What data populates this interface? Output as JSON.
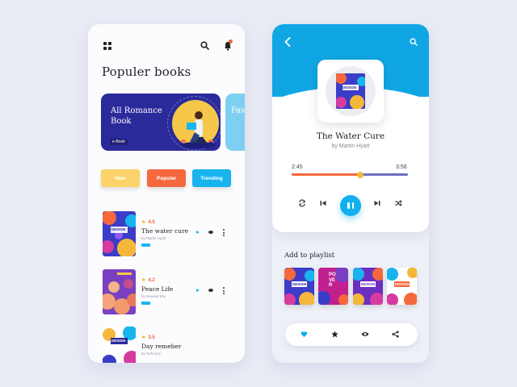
{
  "left": {
    "title": "Populer books",
    "banners": [
      {
        "title": "All  Romance Book",
        "tag": "e-Book"
      },
      {
        "title": "Favr Boo"
      }
    ],
    "filters": [
      "New",
      "Populer",
      "Trending"
    ],
    "books": [
      {
        "rating": "4.5",
        "title": "The water cure",
        "author": "by Martin Hyatt",
        "cover_text": "DESIGN"
      },
      {
        "rating": "4.2",
        "title": "Peace Life",
        "author": "by Naveed Elis",
        "cover_text": ""
      },
      {
        "rating": "3.5",
        "title": "Day remeber",
        "author": "by Nehoney",
        "cover_text": "DESIGN"
      }
    ],
    "icons": [
      "grid-icon",
      "search-icon",
      "bell-icon"
    ]
  },
  "player": {
    "track_title": "The Water Cure",
    "artist": "by Martin Hyatt",
    "current_time": "2:45",
    "total_time": "3:56",
    "progress": 0.59,
    "album_text": "DESIGN",
    "controls": [
      "repeat-icon",
      "previous-icon",
      "pause-icon",
      "next-icon",
      "shuffle-icon"
    ]
  },
  "playlist": {
    "label": "Add to playlist",
    "thumbs": [
      {
        "text": "DESIGN"
      },
      {
        "text": "POVER"
      },
      {
        "text": "DESIGN"
      },
      {
        "text": "DESIGN"
      }
    ],
    "actions": [
      "heart-icon",
      "star-icon",
      "eye-icon",
      "share-icon"
    ]
  },
  "colors": {
    "accent_blue": "#10a6e4",
    "orange": "#f5683e",
    "yellow": "#fbd36a",
    "navy": "#2b2a9b"
  }
}
